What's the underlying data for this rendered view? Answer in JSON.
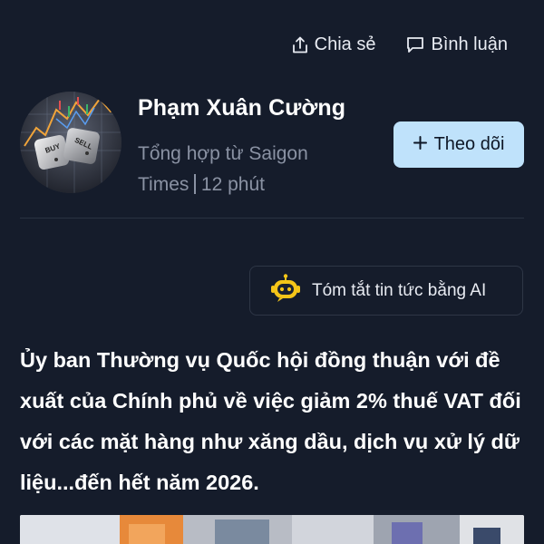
{
  "top_actions": {
    "share_label": "Chia sẻ",
    "comment_label": "Bình luận"
  },
  "author": {
    "name": "Phạm Xuân Cường",
    "source": "Tổng hợp từ Saigon Times",
    "time": "12 phút",
    "avatar_text": {
      "buy": "BUY",
      "sell": "SELL"
    }
  },
  "follow_button": {
    "label": "Theo dõi",
    "background": "#bfe2fb"
  },
  "ai_summary": {
    "label": "Tóm tắt tin tức bằng AI",
    "icon": "ai-robot-icon"
  },
  "article": {
    "headline": "Ủy ban Thường vụ Quốc hội đồng thuận với đề xuất của Chính phủ về việc giảm 2% thuế VAT đối với các mặt hàng như xăng dầu, dịch vụ xử lý dữ liệu...đến hết năm 2026."
  },
  "theme": {
    "background": "#151c2b",
    "muted_text": "#8a92a3"
  }
}
